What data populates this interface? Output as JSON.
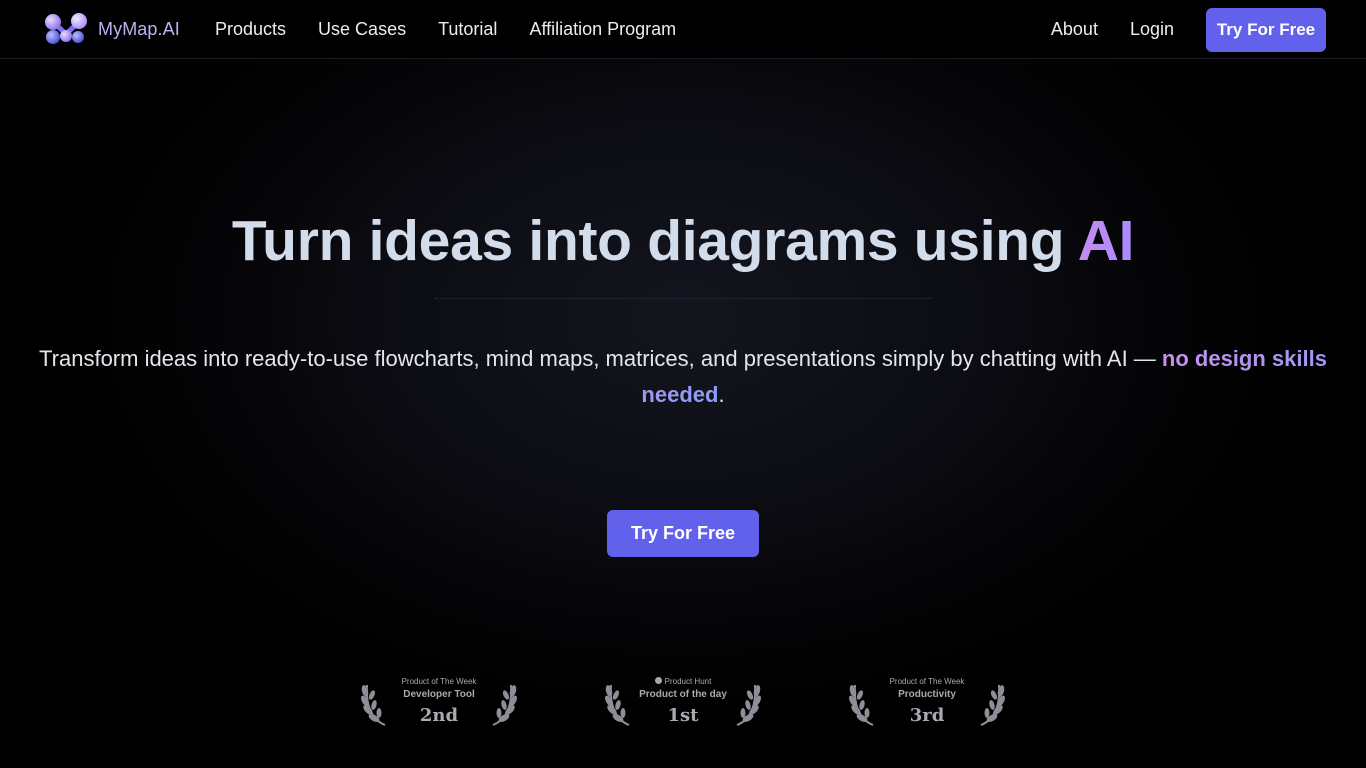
{
  "brand": {
    "name": "MyMap.AI",
    "logo_icon": "molecule-logo-icon",
    "logo_colors": [
      "#9b7cf2",
      "#6a6de8",
      "#c9b8ff",
      "#4b4fd6"
    ]
  },
  "nav": {
    "left_links": [
      {
        "label": "Products"
      },
      {
        "label": "Use Cases"
      },
      {
        "label": "Tutorial"
      },
      {
        "label": "Affiliation Program"
      }
    ],
    "about_label": "About",
    "login_label": "Login",
    "cta_label": "Try For Free"
  },
  "hero": {
    "headline_prefix": "Turn ideas into diagrams using ",
    "headline_accent": "AI",
    "subtitle_prefix": "Transform ideas into ready-to-use flowcharts, mind maps, matrices, and presentations simply by chatting with AI — ",
    "subtitle_highlight": "no design skills needed",
    "subtitle_suffix": ".",
    "cta_label": "Try For Free"
  },
  "awards": [
    {
      "small": "Product of The Week",
      "category": "Developer Tool",
      "rank": "2nd",
      "icon": "laurel-wreath-icon"
    },
    {
      "small": "Product Hunt",
      "category": "Product of the day",
      "rank": "1st",
      "icon": "laurel-wreath-icon"
    },
    {
      "small": "Product of The Week",
      "category": "Productivity",
      "rank": "3rd",
      "icon": "laurel-wreath-icon"
    }
  ],
  "colors": {
    "accent": "#6261ec",
    "headline": "#d3dcea",
    "background": "#000000"
  }
}
